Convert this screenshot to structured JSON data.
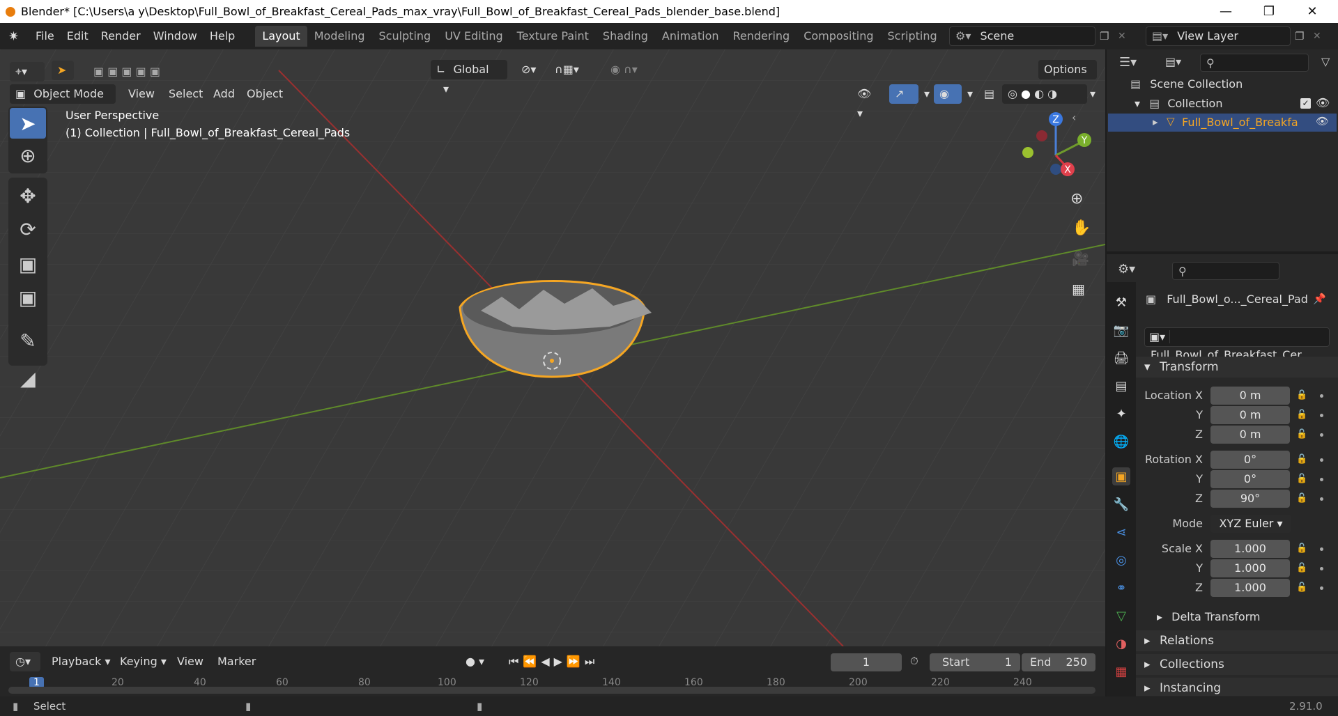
{
  "titlebar": {
    "title": "Blender* [C:\\Users\\a y\\Desktop\\Full_Bowl_of_Breakfast_Cereal_Pads_max_vray\\Full_Bowl_of_Breakfast_Cereal_Pads_blender_base.blend]"
  },
  "menu": [
    "File",
    "Edit",
    "Render",
    "Window",
    "Help"
  ],
  "workspaces": [
    "Layout",
    "Modeling",
    "Sculpting",
    "UV Editing",
    "Texture Paint",
    "Shading",
    "Animation",
    "Rendering",
    "Compositing",
    "Scripting"
  ],
  "active_workspace": "Layout",
  "scene": {
    "value": "Scene"
  },
  "view_layer": {
    "value": "View Layer"
  },
  "tool_header": {
    "orientation": "Global",
    "options": "Options"
  },
  "viewport_header": {
    "mode": "Object Mode",
    "view": "View",
    "select": "Select",
    "add": "Add",
    "object": "Object"
  },
  "viewport": {
    "perspective": "User Perspective",
    "collection_info": "(1) Collection | Full_Bowl_of_Breakfast_Cereal_Pads",
    "gizmo": {
      "z": "Z",
      "y": "Y",
      "x": "X"
    }
  },
  "outliner": {
    "scene_collection": "Scene Collection",
    "collection": "Collection",
    "object": "Full_Bowl_of_Breakfa"
  },
  "properties": {
    "object_name": "Full_Bowl_o..._Cereal_Pad",
    "data_name": "Full_Bowl_of_Breakfast_Cer...",
    "transform_label": "Transform",
    "location": {
      "label": "Location X",
      "x": "0 m",
      "y": "0 m",
      "z": "0 m"
    },
    "rotation": {
      "label": "Rotation X",
      "x": "0°",
      "y": "0°",
      "z": "90°"
    },
    "mode": {
      "label": "Mode",
      "value": "XYZ Euler"
    },
    "scale": {
      "label": "Scale X",
      "x": "1.000",
      "y": "1.000",
      "z": "1.000"
    },
    "axis_y": "Y",
    "axis_z": "Z",
    "sections": [
      "Delta Transform",
      "Relations",
      "Collections",
      "Instancing"
    ]
  },
  "timeline": {
    "playback": "Playback",
    "keying": "Keying",
    "view": "View",
    "marker": "Marker",
    "current_frame": "1",
    "start_label": "Start",
    "start": "1",
    "end_label": "End",
    "end": "250",
    "ruler": [
      "1",
      "20",
      "40",
      "60",
      "80",
      "100",
      "120",
      "140",
      "160",
      "180",
      "200",
      "220",
      "240"
    ]
  },
  "statusbar": {
    "select": "Select",
    "version": "2.91.0"
  },
  "colors": {
    "accent_blue": "#4772b3",
    "selection_orange": "#f5a623",
    "x_axis": "#c8303a",
    "y_axis": "#6f9a2c"
  }
}
